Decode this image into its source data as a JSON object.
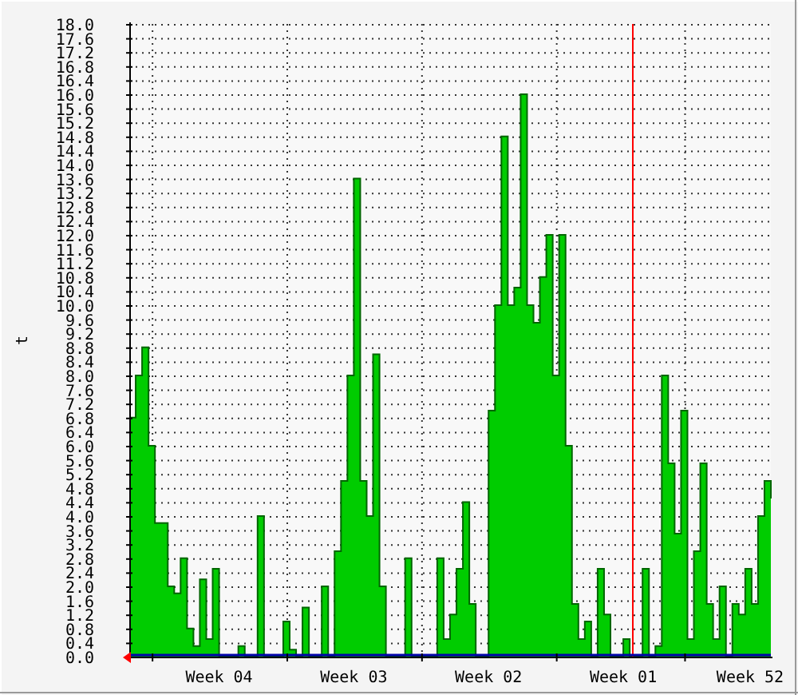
{
  "chart_data": {
    "type": "area",
    "ylabel": "t",
    "categories": [
      null,
      null,
      null,
      null,
      null,
      null,
      null,
      null,
      null,
      null,
      null,
      null,
      null,
      null,
      "Week 04",
      null,
      null,
      null,
      null,
      null,
      null,
      null,
      null,
      null,
      null,
      null,
      null,
      null,
      null,
      null,
      null,
      null,
      null,
      null,
      null,
      "Week 03",
      null,
      null,
      null,
      null,
      null,
      null,
      null,
      null,
      null,
      null,
      null,
      null,
      null,
      null,
      null,
      null,
      null,
      null,
      null,
      null,
      "Week 02",
      null,
      null,
      null,
      null,
      null,
      null,
      null,
      null,
      null,
      null,
      null,
      null,
      null,
      null,
      null,
      null,
      null,
      null,
      null,
      null,
      "Week 01",
      null,
      null,
      null,
      null,
      null,
      null,
      null,
      null,
      null,
      null,
      null,
      null,
      null,
      null,
      null,
      null,
      null,
      null,
      null,
      "Week 52",
      null,
      null,
      null
    ],
    "series": [
      {
        "color": "#00cc00",
        "values": [
          6.8,
          8.0,
          8.8,
          6.0,
          3.8,
          3.8,
          2.0,
          1.8,
          2.8,
          0.8,
          0.3,
          2.2,
          0.5,
          2.5,
          0,
          0,
          0,
          0.3,
          0,
          0,
          4.0,
          0,
          0,
          0,
          1.0,
          0.2,
          0,
          1.4,
          0,
          0,
          2.0,
          0,
          3.0,
          5.0,
          8.0,
          13.6,
          5.0,
          4.0,
          8.6,
          2.0,
          0,
          0,
          0,
          2.8,
          0,
          0,
          0,
          0,
          2.8,
          0.5,
          1.2,
          2.5,
          4.4,
          1.5,
          0,
          0,
          7.0,
          10.0,
          14.8,
          10.0,
          10.5,
          16.0,
          10.0,
          9.5,
          10.8,
          12.0,
          8.0,
          12.0,
          6.0,
          1.5,
          0.5,
          1.0,
          0,
          2.5,
          1.2,
          0,
          0,
          0.5,
          0,
          0,
          2.5,
          0,
          0.3,
          8.0,
          5.5,
          3.5,
          7.0,
          0.5,
          3.0,
          5.5,
          1.5,
          0.5,
          2.0,
          0,
          1.5,
          1.2,
          2.5,
          1.5,
          4.0,
          5.0,
          4.5
        ]
      }
    ],
    "ylim": [
      0,
      18
    ],
    "yticks": [
      {
        "value": 0,
        "label": "0.0"
      },
      {
        "value": 0.4,
        "label": "0.4"
      },
      {
        "value": 0.8,
        "label": "0.8"
      },
      {
        "value": 1.2,
        "label": "1.2"
      },
      {
        "value": 1.6,
        "label": "1.6"
      },
      {
        "value": 2,
        "label": "2.0"
      },
      {
        "value": 2.4,
        "label": "2.4"
      },
      {
        "value": 2.8,
        "label": "2.8"
      },
      {
        "value": 3.2,
        "label": "3.2"
      },
      {
        "value": 3.6,
        "label": "3.6"
      },
      {
        "value": 4,
        "label": "4.0"
      },
      {
        "value": 4.4,
        "label": "4.4"
      },
      {
        "value": 4.8,
        "label": "4.8"
      },
      {
        "value": 5.2,
        "label": "5.2"
      },
      {
        "value": 5.6,
        "label": "5.6"
      },
      {
        "value": 6,
        "label": "6.0"
      },
      {
        "value": 6.4,
        "label": "6.4"
      },
      {
        "value": 6.8,
        "label": "6.8"
      },
      {
        "value": 7.2,
        "label": "7.2"
      },
      {
        "value": 7.6,
        "label": "7.6"
      },
      {
        "value": 8,
        "label": "8.0"
      },
      {
        "value": 8.4,
        "label": "8.4"
      },
      {
        "value": 8.8,
        "label": "8.8"
      },
      {
        "value": 9.2,
        "label": "9.2"
      },
      {
        "value": 9.6,
        "label": "9.6"
      },
      {
        "value": 10,
        "label": "10.0"
      },
      {
        "value": 10.4,
        "label": "10.4"
      },
      {
        "value": 10.8,
        "label": "10.8"
      },
      {
        "value": 11.2,
        "label": "11.2"
      },
      {
        "value": 11.6,
        "label": "11.6"
      },
      {
        "value": 12,
        "label": "12.0"
      },
      {
        "value": 12.4,
        "label": "12.4"
      },
      {
        "value": 12.8,
        "label": "12.8"
      },
      {
        "value": 13.2,
        "label": "13.2"
      },
      {
        "value": 13.6,
        "label": "13.6"
      },
      {
        "value": 14,
        "label": "14.0"
      },
      {
        "value": 14.4,
        "label": "14.4"
      },
      {
        "value": 14.8,
        "label": "14.8"
      },
      {
        "value": 15.2,
        "label": "15.2"
      },
      {
        "value": 15.6,
        "label": "15.6"
      },
      {
        "value": 16,
        "label": "16.0"
      },
      {
        "value": 16.4,
        "label": "16.4"
      },
      {
        "value": 16.8,
        "label": "16.8"
      },
      {
        "value": 17.2,
        "label": "17.2"
      },
      {
        "value": 17.6,
        "label": "17.6"
      },
      {
        "value": 18,
        "label": "18.0"
      }
    ],
    "grid": true
  }
}
